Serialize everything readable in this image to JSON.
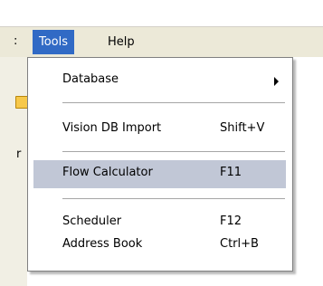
{
  "menubar": {
    "left_fragment": ":",
    "menus": [
      {
        "label": "Tools",
        "active": true
      },
      {
        "label": "Help",
        "active": false
      }
    ]
  },
  "left_strip": {
    "letter": "r",
    "folder_icon": "folder-icon"
  },
  "dropdown": {
    "items": [
      {
        "label": "Database",
        "shortcut": "",
        "submenu": true,
        "highlighted": false
      },
      {
        "label": "Vision DB Import",
        "shortcut": "Shift+V",
        "submenu": false,
        "highlighted": false
      },
      {
        "label": "Flow Calculator",
        "shortcut": "F11",
        "submenu": false,
        "highlighted": true
      },
      {
        "label": "Scheduler",
        "shortcut": "F12",
        "submenu": false,
        "highlighted": false
      },
      {
        "label": "Address Book",
        "shortcut": "Ctrl+B",
        "submenu": false,
        "highlighted": false
      }
    ]
  },
  "colors": {
    "menu_highlight": "#316ac5",
    "item_highlight": "#c1c7d6",
    "menubar_bg": "#ece9d8"
  }
}
